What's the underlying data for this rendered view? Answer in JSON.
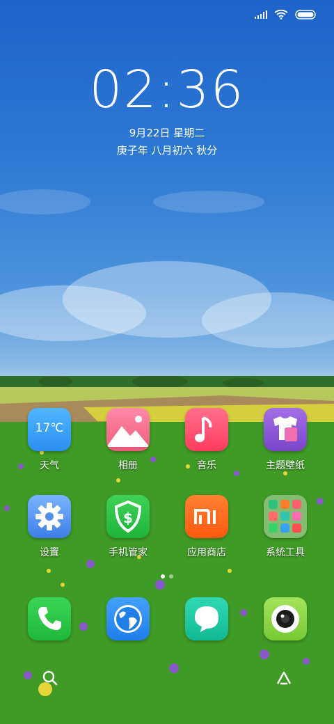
{
  "status": {
    "signal_icon": "signal-icon",
    "wifi_icon": "wifi-icon",
    "battery_icon": "battery-icon"
  },
  "lockclock": {
    "time": "02:36",
    "date": "9月22日 星期二",
    "lunar": "庚子年 八月初六 秋分"
  },
  "apps_row1": [
    {
      "label": "天气",
      "icon": "weather-icon",
      "badge": "17℃"
    },
    {
      "label": "相册",
      "icon": "gallery-icon"
    },
    {
      "label": "音乐",
      "icon": "music-icon"
    },
    {
      "label": "主题壁纸",
      "icon": "themes-icon"
    }
  ],
  "apps_row2": [
    {
      "label": "设置",
      "icon": "settings-icon"
    },
    {
      "label": "手机管家",
      "icon": "security-icon"
    },
    {
      "label": "应用商店",
      "icon": "app-store-icon"
    },
    {
      "label": "系统工具",
      "icon": "folder-icon"
    }
  ],
  "dock": [
    {
      "icon": "phone-icon"
    },
    {
      "icon": "browser-icon"
    },
    {
      "icon": "messages-icon"
    },
    {
      "icon": "camera-icon"
    }
  ],
  "page_indicator": {
    "pages": 2,
    "active": 1
  },
  "bottom": {
    "left_icon": "search-icon",
    "right_icon": "app-vault-icon"
  },
  "colors": {
    "weather": "#3aa3f5",
    "gallery": "#f46a8c",
    "music": "#ff4f6d",
    "themes": "#8e59d6",
    "settings": "#4f8ff0",
    "security": "#2ec245",
    "app_store": "#ff6a1a",
    "phone": "#2dc74a",
    "browser": "#2f8ef2",
    "messages": "#22c7a5",
    "camera": "#8ed64a"
  }
}
